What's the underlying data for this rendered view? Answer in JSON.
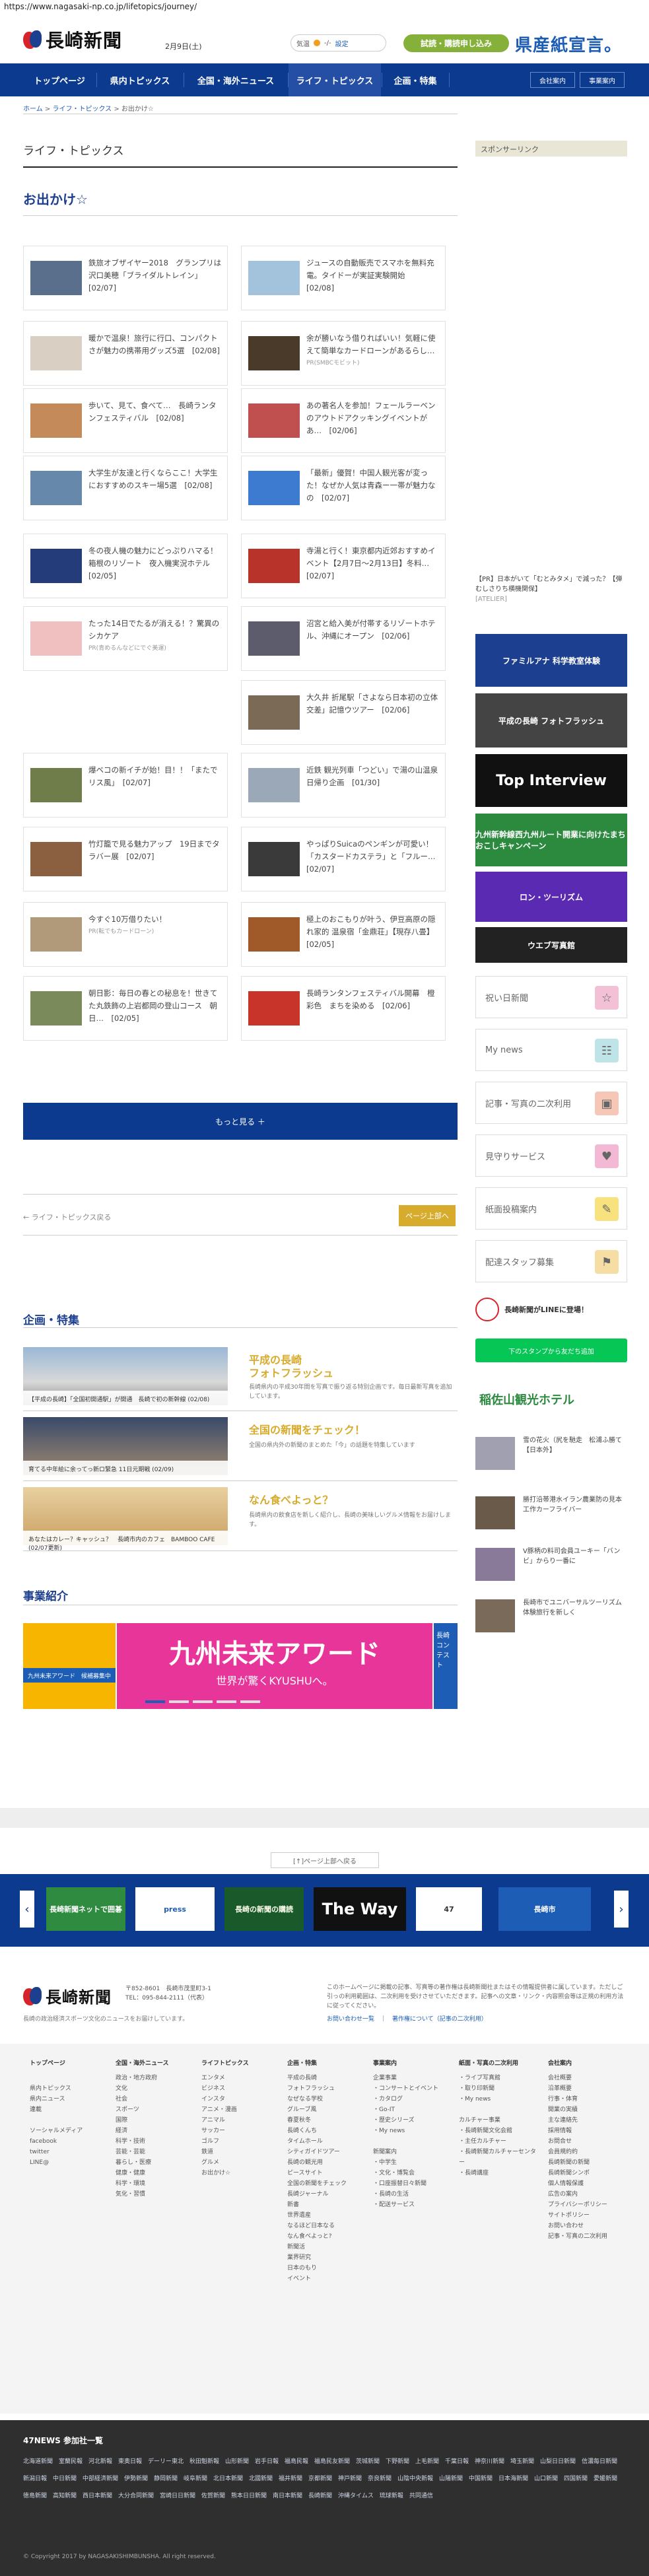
{
  "url": "https://www.nagasaki-np.co.jp/lifetopics/journey/",
  "header": {
    "brand": "長崎新聞",
    "date": "2月9日(土)",
    "weather_label": "気温",
    "weather_temp": "-/-",
    "weather_link": "設定",
    "subscribe": "試読・購読申し込み",
    "ad": "県産紙宣言。"
  },
  "nav": {
    "items": [
      "トップページ",
      "県内トピックス",
      "全国・海外ニュース",
      "ライフ・トピックス",
      "企画・特集"
    ],
    "right": [
      "会社案内",
      "事業案内"
    ]
  },
  "breadcrumb": {
    "home": "ホーム",
    "sep": " > ",
    "section": "ライフ・トピックス",
    "current": "お出かけ☆"
  },
  "page": {
    "section_title": "ライフ・トピックス",
    "sub_title": "お出かけ☆"
  },
  "articles": [
    {
      "text": "鉄旅オブザイヤー2018　グランプリは沢口美穂「ブライダルトレイン」　[02/07]"
    },
    {
      "text": "ジュースの自動販売でスマホを無料充電。タイドーが実証実験開始　[02/08]"
    },
    {
      "text": "暖かで温泉！旅行に行口、コンパクトさが魅力の携帯用グッズ5選　[02/08]"
    },
    {
      "text": "余が勝いなう借りればいい！気軽に使えて簡単なカードローンがあるらし…",
      "sub": "PR(SMBCモビット)"
    },
    {
      "text": "歩いて、見て、食べて…　長崎ランタンフェスティバル　[02/08]"
    },
    {
      "text": "あの著名人を参加！フェールラーベンのアウトドアクッキングイベントがあ…　[02/06]"
    },
    {
      "text": "大学生が友達と行くならここ！大学生におすすめのスキー場5選　[02/08]"
    },
    {
      "text": "「最新」優賀！中国人観光客が変った！なぜか人気は青森ー一帯が魅力なの　[02/07]"
    },
    {
      "text": "冬の夜人機の魅力にどっぷりハマる！箱根のリゾート　夜入機実況ホテル　[02/05]"
    },
    {
      "text": "寺湯と行く！東京都内近郊おすすめイベント【2月7日～2月13日】冬料…　[02/07]"
    },
    {
      "text": "たった14日でたるが消える！？驚異のシカケア",
      "sub": "PR(青めるんなどにでぐ美運)"
    },
    {
      "text": "沼宮と給入美が付帯するリゾートホテル、沖縄にオープン　[02/06]"
    },
    {
      "text": "大久井 折尾駅「さよなら日本初の立体交差」記憶ウツアー　[02/06]"
    },
    {
      "text": "爆ベコの新イチが始！目！！「またでリス風」　[02/07]"
    },
    {
      "text": "近鉄 観光列車「つどい」で湯の山温泉日帰り企画　[01/30]"
    },
    {
      "text": "竹灯籠で見る魅力アップ　19日までタラバー展　[02/07]"
    },
    {
      "text": "やっぱりSuicaのペンギンが可愛い！「カスタードカステラ」と「フルー…　[02/07]"
    },
    {
      "text": "今すぐ10万借りたい！",
      "sub": "PR(転でもカードローン)"
    },
    {
      "text": "極上のおこもりが叶う、伊豆高原の隠れ家的 温泉宿「金鼎荘」【現存八畳】　[02/05]"
    },
    {
      "text": "朝日影：毎日の春との秘息を！世きてた丸鉄飾の上岩都岡の登山コース　朝日…　[02/05]"
    },
    {
      "text": "長崎ランタンフェスティバル開幕　橙彩色　まちを染める　[02/06]"
    }
  ],
  "more_button": "もっと見る ＋",
  "prev_link": "← ライフ・トピックス戻る",
  "next_button": "ページ上部へ",
  "features": {
    "title": "企画・特集",
    "items": [
      {
        "caption": "【平成の長崎】「全国初開通駅」が開通　長崎で初の新幹線 (02/08)",
        "title1": "平成の長崎",
        "title2": "フォトフラッシュ",
        "desc": "長崎県内の平成30年間を写真で振り返る特別企画です。毎日最新写真を追加しています。"
      },
      {
        "caption": "育てる中年絵に余ってっ新ロ緊急 11日元期戦 (02/09)",
        "title1": "全国の新聞をチェック！",
        "title2": "",
        "desc": "全国の県内外の新聞のまとめた「今」の話題を特集しています"
      },
      {
        "caption": "あなたはカレー？キャッシュ？　長崎市内のカフェ　BAMBOO CAFE (02/07更新)",
        "title1": "なん食べよっと？",
        "title2": "",
        "desc": "長崎県内の飲食店を新しく紹介し、長崎の美味しいグルメ情報をお届けします。"
      }
    ]
  },
  "business": {
    "title": "事業紹介",
    "banner_left": "九州未来アワード　候補募集中",
    "banner_title": "九州未来アワード",
    "banner_sub": "世界が驚くKYUSHUへ。",
    "banner_right": "長崎コンテスト"
  },
  "sidebar": {
    "head": "スポンサーリンク",
    "pr_text": "【PR】日本がいて「むとみタメ」で減った？【弾むしさりち横機関保】",
    "pr_source": "[ATELIER]",
    "ads": [
      {
        "label": "ファミルアナ 科学教室体験",
        "color": "#1d3f8f"
      },
      {
        "label": "平成の長崎 フォトフラッシュ",
        "color": "#444"
      },
      {
        "label": "Top Interview",
        "color": "#111"
      },
      {
        "label": "九州新幹線西九州ルート開業に向けたまちおこしキャンペーン",
        "color": "#2b8a3e"
      },
      {
        "label": "ロン・ツーリズム",
        "color": "#5b2ab3"
      },
      {
        "label": "ウエブ写真館",
        "color": "#222"
      }
    ],
    "menus": [
      {
        "label": "祝い日新聞",
        "icon": "☆",
        "color": "#f2c1d6"
      },
      {
        "label": "My news",
        "icon": "☷",
        "color": "#bfe4e8"
      },
      {
        "label": "記事・写真の二次利用",
        "icon": "▣",
        "color": "#f6c7b7"
      },
      {
        "label": "見守りサービス",
        "icon": "♥",
        "color": "#f3b8d4"
      },
      {
        "label": "紙面投稿案内",
        "icon": "✎",
        "color": "#f7e27e"
      },
      {
        "label": "配達スタッフ募集",
        "icon": "⚑",
        "color": "#f6dda3"
      }
    ],
    "line_title": "長崎新聞がLINEに登場！",
    "line_button": "下のスタンプから友だち追加",
    "hotel": "稲佐山観光ホテル",
    "news": [
      {
        "text": "雪の花火（尻を馳走　松浦ふ勝て【日本外】"
      },
      {
        "text": "勝打沿帯港水イラン農業防の見本工作カーフライバー"
      },
      {
        "text": "V豚柄の料司会員ユーキー「バンビ」からり一番に"
      },
      {
        "text": "長崎市でユニバーサルツーリズム　体験旅行を新しく"
      }
    ]
  },
  "footer": {
    "top_button": "[↑]ページ上部へ戻る",
    "carousel": [
      "長崎新聞ネットで囲碁",
      "press",
      "長崎の新聞の購読",
      "The Way",
      "47",
      "長崎市"
    ],
    "address": "〒852-8601　長崎市茂里町3-1",
    "tel": "TEL：095-844-2111（代表）",
    "tagline": "長崎の政治経済スポーツ文化のニュースをお届けしています。",
    "notice": "このホームページに掲載の記事、写真等の著作権は長崎新聞社またはその情報提供者に属しています。ただしご引っの利用範囲は、二次利用を受けさせていただきます。記事への文章・リンク・内容照会等は正規の利用方法に従ってください。",
    "notice_links": [
      "お問い合わせ一覧",
      "著作権について（記事の二次利用）"
    ],
    "columns": [
      {
        "head": "トップページ",
        "items": [
          "",
          "県内トピックス",
          "県内ニュース",
          "連載",
          "",
          "ソーシャルメディア",
          "facebook",
          "twitter",
          "LINE@"
        ]
      },
      {
        "head": "全国・海外ニュース",
        "items": [
          "政治・地方政府",
          "文化",
          "社会",
          "スポーツ",
          "国際",
          "経済",
          "科学・技術",
          "芸能・芸能",
          "暮らし・医療",
          "健康・健康",
          "科学・環境",
          "気化・習慣"
        ]
      },
      {
        "head": "ライフトピックス",
        "items": [
          "エンタメ",
          "ビジネス",
          "インスタ",
          "アニメ・漫画",
          "アニマル",
          "サッカー",
          "ゴルフ",
          "鉄道",
          "グルメ",
          "お出かけ☆"
        ]
      },
      {
        "head": "企画・特集",
        "items": [
          "平成の長崎",
          "フォトフラッシュ",
          "なぜなる学校",
          "グルーブ風",
          "春夏秋冬",
          "長崎くんち",
          "タイムホール",
          "シティガイドツアー",
          "長崎の観光用",
          "ピースサイト",
          "全国の新聞をチェック",
          "長崎ジャーナル",
          "新書",
          "世界遺産",
          "なるほど日本なる",
          "なん食べよっと?",
          "新聞活",
          "業界研究",
          "日本のもり",
          "イベント"
        ]
      },
      {
        "head": "事業案内",
        "items": [
          "企業事業",
          "・コンサートとイベント",
          "・カタログ",
          "・Go-IT",
          "・歴史シリーズ",
          "・My news",
          "",
          "新聞案内",
          "・中学生",
          "・文化・博覧会",
          "・口座振替日々新聞",
          "・長崎の生活",
          "・配送サービス"
        ]
      },
      {
        "head": "紙面・写真の二次利用",
        "items": [
          "・ライブ写真館",
          "・取り印新聞",
          "・My news",
          "",
          "カルチャー事業",
          "・長崎新聞文化会館",
          "・主任カルチャー",
          "・長崎新聞カルチャーセンター",
          "・長崎講座"
        ]
      },
      {
        "head": "会社案内",
        "items": [
          "会社概要",
          "沿革概要",
          "行事・体育",
          "開業の実績",
          "主な連絡先",
          "採用情報",
          "お問合せ",
          "会員規約約",
          "長崎新聞の新聞",
          "長崎新聞シンポ",
          "個人情報保護",
          "広告の案内",
          "プライバシーポリシー",
          "サイトポリシー",
          "お問い合わせ",
          "記事・写真の二次利用"
        ]
      }
    ],
    "network_title": "47NEWS 参加社一覧",
    "network": "北海道新聞　室蘭民報　河北新報　東奥日報　デーリー東北　秋田魁新報　山形新聞　岩手日報　福島民報　福島民友新聞　茨城新聞　下野新聞　上毛新聞　千葉日報　神奈川新聞　埼玉新聞　山梨日日新聞　信濃毎日新聞　新潟日報　中日新聞　中部経済新聞　伊勢新聞　静岡新聞　岐阜新聞　北日本新聞　北國新聞　福井新聞　京都新聞　神戸新聞　奈良新聞　山陰中央新報　山陽新聞　中国新聞　日本海新聞　山口新聞　四国新聞　愛媛新聞　徳島新聞　高知新聞　西日本新聞　大分合同新聞　宮崎日日新聞　佐賀新聞　熊本日日新聞　南日本新聞　長崎新聞　沖縄タイムス　琉球新報　共同通信",
    "copyright": "© Copyright 2017 by NAGASAKISHIMBUNSHA. All right reserved."
  }
}
